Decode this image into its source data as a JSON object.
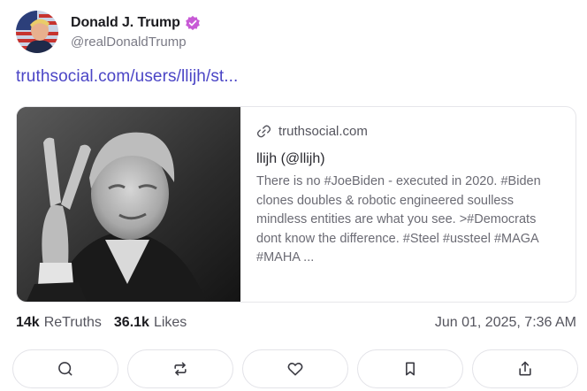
{
  "author": {
    "display_name": "Donald J. Trump",
    "handle": "@realDonaldTrump",
    "verified_color": "#c85ad6"
  },
  "post": {
    "link_text": "truthsocial.com/users/llijh/st..."
  },
  "card": {
    "domain": "truthsocial.com",
    "title": "llijh (@llijh)",
    "description": "There is no #JoeBiden - executed in 2020. #Biden clones doubles & robotic engineered soulless mindless entities are what you see. >#Democrats dont know the difference. #Steel #ussteel #MAGA #MAHA ..."
  },
  "stats": {
    "retruths_count": "14k",
    "retruths_label": "ReTruths",
    "likes_count": "36.1k",
    "likes_label": "Likes",
    "timestamp": "Jun 01, 2025, 7:36 AM"
  },
  "actions": {
    "icons": [
      "reply-icon",
      "retruth-icon",
      "like-icon",
      "bookmark-icon",
      "share-icon"
    ]
  },
  "colors": {
    "link": "#4b45c6",
    "muted_text": "#6b6b74"
  }
}
